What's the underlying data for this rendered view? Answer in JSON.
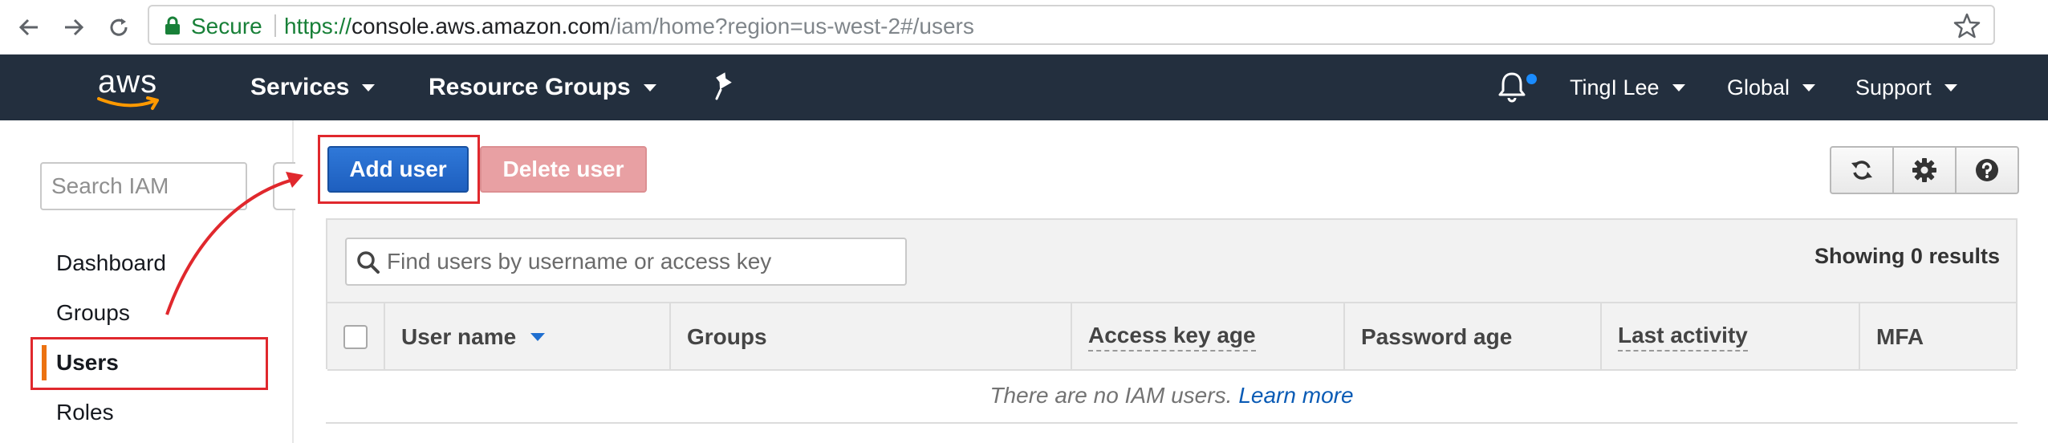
{
  "browser": {
    "secure_label": "Secure",
    "url_scheme": "https://",
    "url_host": "console.aws.amazon.com",
    "url_path": "/iam/home?region=us-west-2#/users"
  },
  "aws_nav": {
    "logo_text": "aws",
    "services_label": "Services",
    "resource_groups_label": "Resource Groups",
    "user_label": "TingI Lee",
    "region_label": "Global",
    "support_label": "Support"
  },
  "sidebar": {
    "search_placeholder": "Search IAM",
    "items": [
      {
        "label": "Dashboard"
      },
      {
        "label": "Groups"
      },
      {
        "label": "Users"
      },
      {
        "label": "Roles"
      }
    ],
    "active_item": "Users"
  },
  "toolbar": {
    "add_user_label": "Add user",
    "delete_user_label": "Delete user"
  },
  "users_table": {
    "filter_placeholder": "Find users by username or access key",
    "results_text": "Showing 0 results",
    "columns": [
      "User name",
      "Groups",
      "Access key age",
      "Password age",
      "Last activity",
      "MFA"
    ],
    "empty_text": "There are no IAM users.",
    "learn_more_label": "Learn more"
  },
  "colors": {
    "aws_nav_bg": "#232f3e",
    "primary_button": "#1e5fbf",
    "danger_button": "#e8a0a3",
    "active_marker": "#ec7211",
    "annotation_red": "#e0282d"
  }
}
